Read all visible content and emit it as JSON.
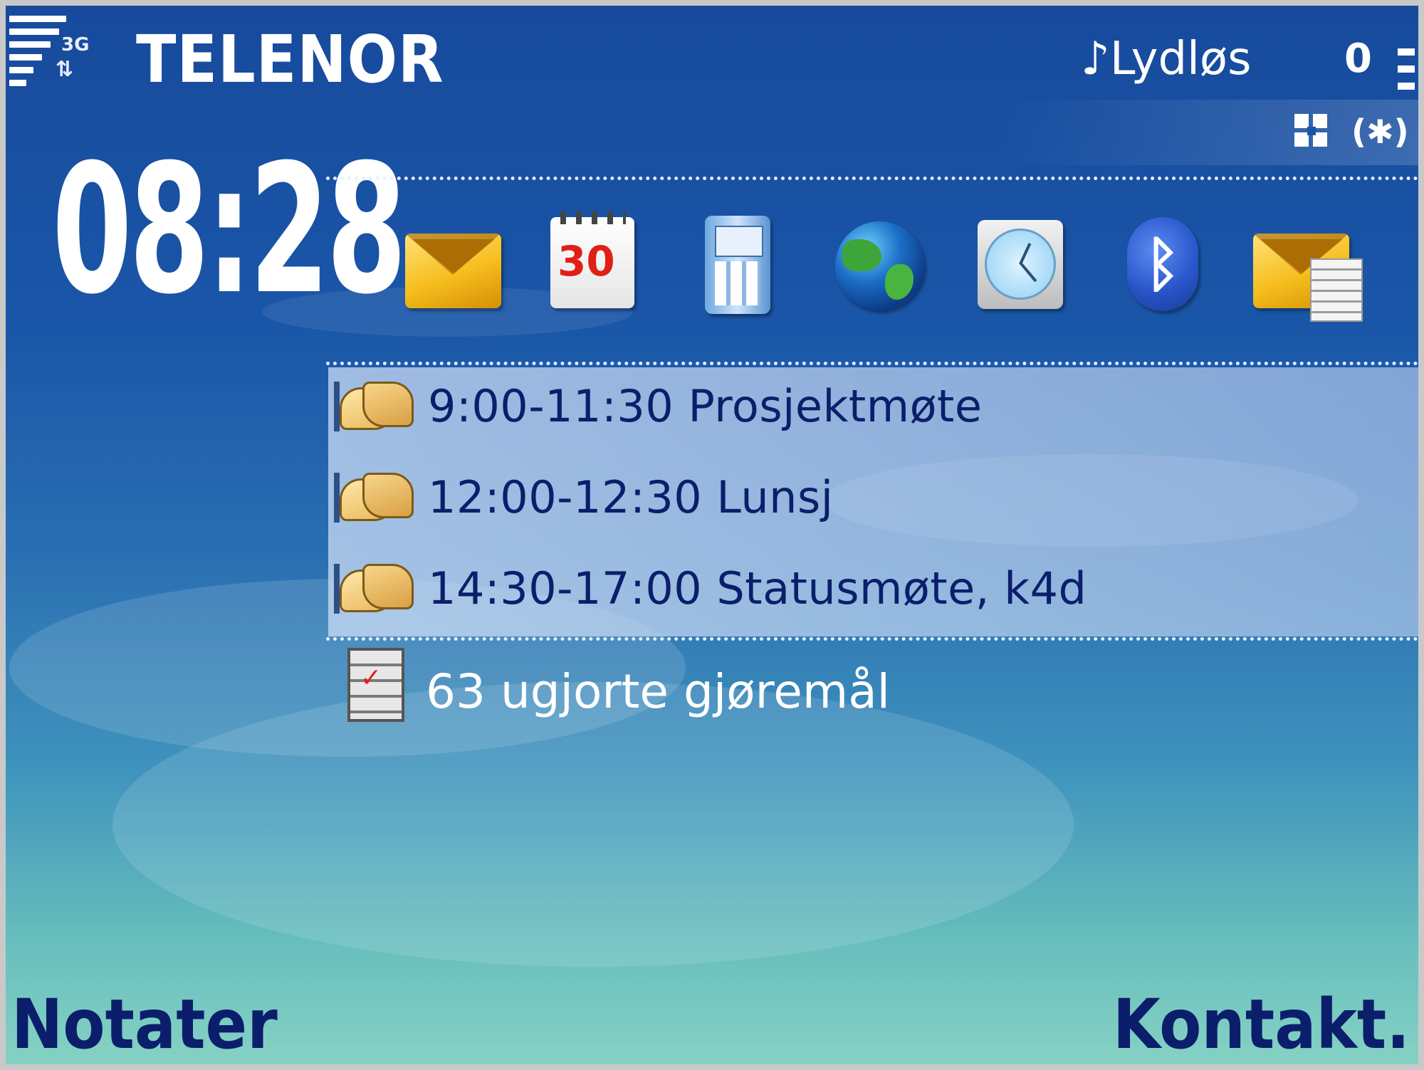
{
  "status_bar": {
    "network_type": "3G",
    "operator": "TELENOR",
    "profile": "Lydløs",
    "message_count": "0"
  },
  "clock": {
    "time": "08:28"
  },
  "shortcuts": [
    {
      "icon": "messaging-icon"
    },
    {
      "icon": "calendar-icon",
      "badge": "30"
    },
    {
      "icon": "mobile-icon"
    },
    {
      "icon": "web-globe-icon"
    },
    {
      "icon": "clock-icon"
    },
    {
      "icon": "bluetooth-icon"
    },
    {
      "icon": "email-icon"
    }
  ],
  "agenda": [
    {
      "icon": "meeting-icon",
      "text": "9:00-11:30 Prosjektmøte"
    },
    {
      "icon": "meeting-icon",
      "text": "12:00-12:30 Lunsj"
    },
    {
      "icon": "meeting-icon",
      "text": "14:30-17:00 Statusmøte, k4d"
    }
  ],
  "todo": {
    "icon": "todo-icon",
    "text": "63 ugjorte gjøremål"
  },
  "softkeys": {
    "left": "Notater",
    "right": "Kontakt."
  },
  "colors": {
    "background_top": "#174a9c",
    "background_bottom": "#86d2c4",
    "agenda_text": "#0b1e6b",
    "softkey_text": "#0b1e6b"
  }
}
